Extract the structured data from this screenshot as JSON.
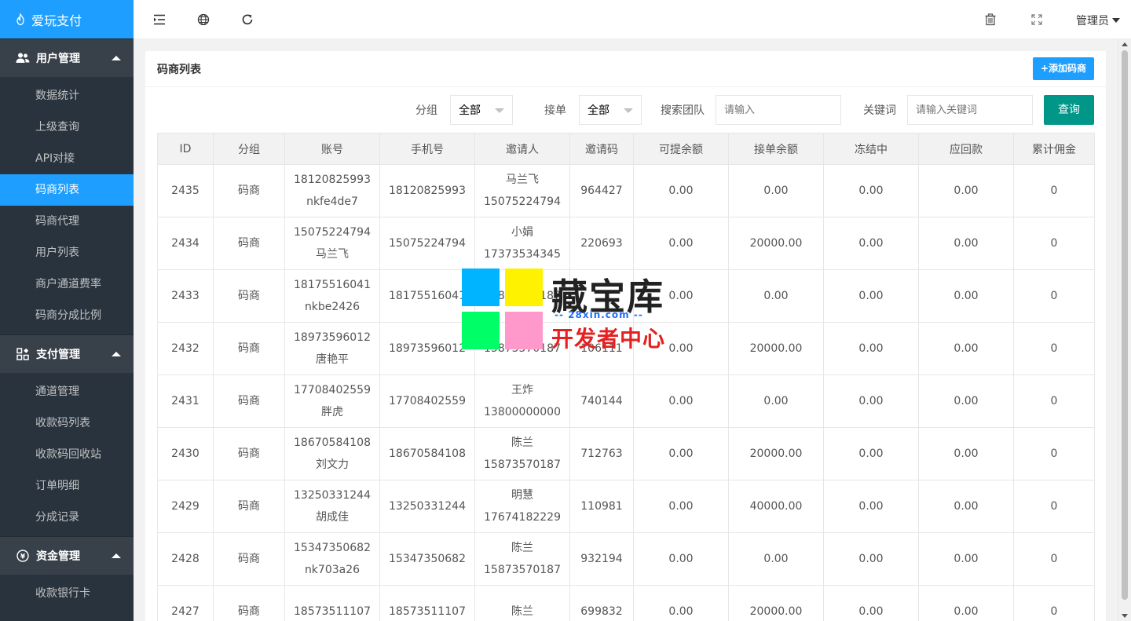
{
  "sidebar": {
    "logo": "爱玩支付",
    "groups": [
      {
        "title": "用户管理",
        "items": [
          "数据统计",
          "上级查询",
          "API对接",
          "码商列表",
          "码商代理",
          "用户列表",
          "商户通道费率",
          "码商分成比例"
        ]
      },
      {
        "title": "支付管理",
        "items": [
          "通道管理",
          "收款码列表",
          "收款码回收站",
          "订单明细",
          "分成记录"
        ]
      },
      {
        "title": "资金管理",
        "items": [
          "收款银行卡"
        ]
      }
    ],
    "active_item": "码商列表"
  },
  "header": {
    "admin_label": "管理员"
  },
  "card": {
    "title": "码商列表",
    "add_button": "+添加码商"
  },
  "filter": {
    "group_label": "分组",
    "group_value": "全部",
    "order_label": "接单",
    "order_value": "全部",
    "team_label": "搜索团队",
    "team_placeholder": "请输入",
    "keyword_label": "关键词",
    "keyword_placeholder": "请输入关键词",
    "query_button": "查询"
  },
  "table": {
    "columns": [
      "ID",
      "分组",
      "账号",
      "手机号",
      "邀请人",
      "邀请码",
      "可提余额",
      "接单余额",
      "冻结中",
      "应回款",
      "累计佣金"
    ],
    "rows": [
      {
        "id": "2435",
        "group": "码商",
        "account": "18120825993",
        "account_name": "nkfe4de7",
        "phone": "18120825993",
        "inviter": "马兰飞",
        "inviter_phone": "15075224794",
        "code": "964427",
        "withdrawable": "0.00",
        "order_balance": "0.00",
        "frozen": "0.00",
        "payback": "0.00",
        "commission": "0"
      },
      {
        "id": "2434",
        "group": "码商",
        "account": "15075224794",
        "account_name": "马兰飞",
        "phone": "15075224794",
        "inviter": "小娟",
        "inviter_phone": "17373534345",
        "code": "220693",
        "withdrawable": "0.00",
        "order_balance": "20000.00",
        "frozen": "0.00",
        "payback": "0.00",
        "commission": "0"
      },
      {
        "id": "2433",
        "group": "码商",
        "account": "18175516041",
        "account_name": "nkbe2426",
        "phone": "18175516041",
        "inviter": "",
        "inviter_phone": "15873570187",
        "code": "",
        "withdrawable": "0.00",
        "order_balance": "0.00",
        "frozen": "0.00",
        "payback": "0.00",
        "commission": "0"
      },
      {
        "id": "2432",
        "group": "码商",
        "account": "18973596012",
        "account_name": "唐艳平",
        "phone": "18973596012",
        "inviter": "",
        "inviter_phone": "15873570187",
        "code": "106111",
        "withdrawable": "0.00",
        "order_balance": "20000.00",
        "frozen": "0.00",
        "payback": "0.00",
        "commission": "0"
      },
      {
        "id": "2431",
        "group": "码商",
        "account": "17708402559",
        "account_name": "胖虎",
        "phone": "17708402559",
        "inviter": "王炸",
        "inviter_phone": "13800000000",
        "code": "740144",
        "withdrawable": "0.00",
        "order_balance": "0.00",
        "frozen": "0.00",
        "payback": "0.00",
        "commission": "0"
      },
      {
        "id": "2430",
        "group": "码商",
        "account": "18670584108",
        "account_name": "刘文力",
        "phone": "18670584108",
        "inviter": "陈兰",
        "inviter_phone": "15873570187",
        "code": "712763",
        "withdrawable": "0.00",
        "order_balance": "20000.00",
        "frozen": "0.00",
        "payback": "0.00",
        "commission": "0"
      },
      {
        "id": "2429",
        "group": "码商",
        "account": "13250331244",
        "account_name": "胡成佳",
        "phone": "13250331244",
        "inviter": "明慧",
        "inviter_phone": "17674182229",
        "code": "110981",
        "withdrawable": "0.00",
        "order_balance": "40000.00",
        "frozen": "0.00",
        "payback": "0.00",
        "commission": "0"
      },
      {
        "id": "2428",
        "group": "码商",
        "account": "15347350682",
        "account_name": "nk703a26",
        "phone": "15347350682",
        "inviter": "陈兰",
        "inviter_phone": "15873570187",
        "code": "932194",
        "withdrawable": "0.00",
        "order_balance": "0.00",
        "frozen": "0.00",
        "payback": "0.00",
        "commission": "0"
      },
      {
        "id": "2427",
        "group": "码商",
        "account": "18573511107",
        "account_name": "",
        "phone": "18573511107",
        "inviter": "陈兰",
        "inviter_phone": "",
        "code": "699832",
        "withdrawable": "0.00",
        "order_balance": "20000.00",
        "frozen": "0.00",
        "payback": "0.00",
        "commission": "0"
      }
    ]
  },
  "watermark": {
    "brand": "藏宝库",
    "site": "-- 28xin.com --",
    "sub": "开发者中心",
    "colors": [
      "#00b4ff",
      "#fff200",
      "#00ff66",
      "#ff99cc"
    ]
  },
  "icons": {
    "logo": "flame-icon",
    "menu_toggle": "menu-fold-icon",
    "globe": "globe-icon",
    "refresh": "refresh-icon",
    "trash": "trash-icon",
    "fullscreen": "fullscreen-icon"
  },
  "colors": {
    "primary": "#1e9fff",
    "sidebar_bg": "#28333e",
    "query_button": "#009688"
  }
}
